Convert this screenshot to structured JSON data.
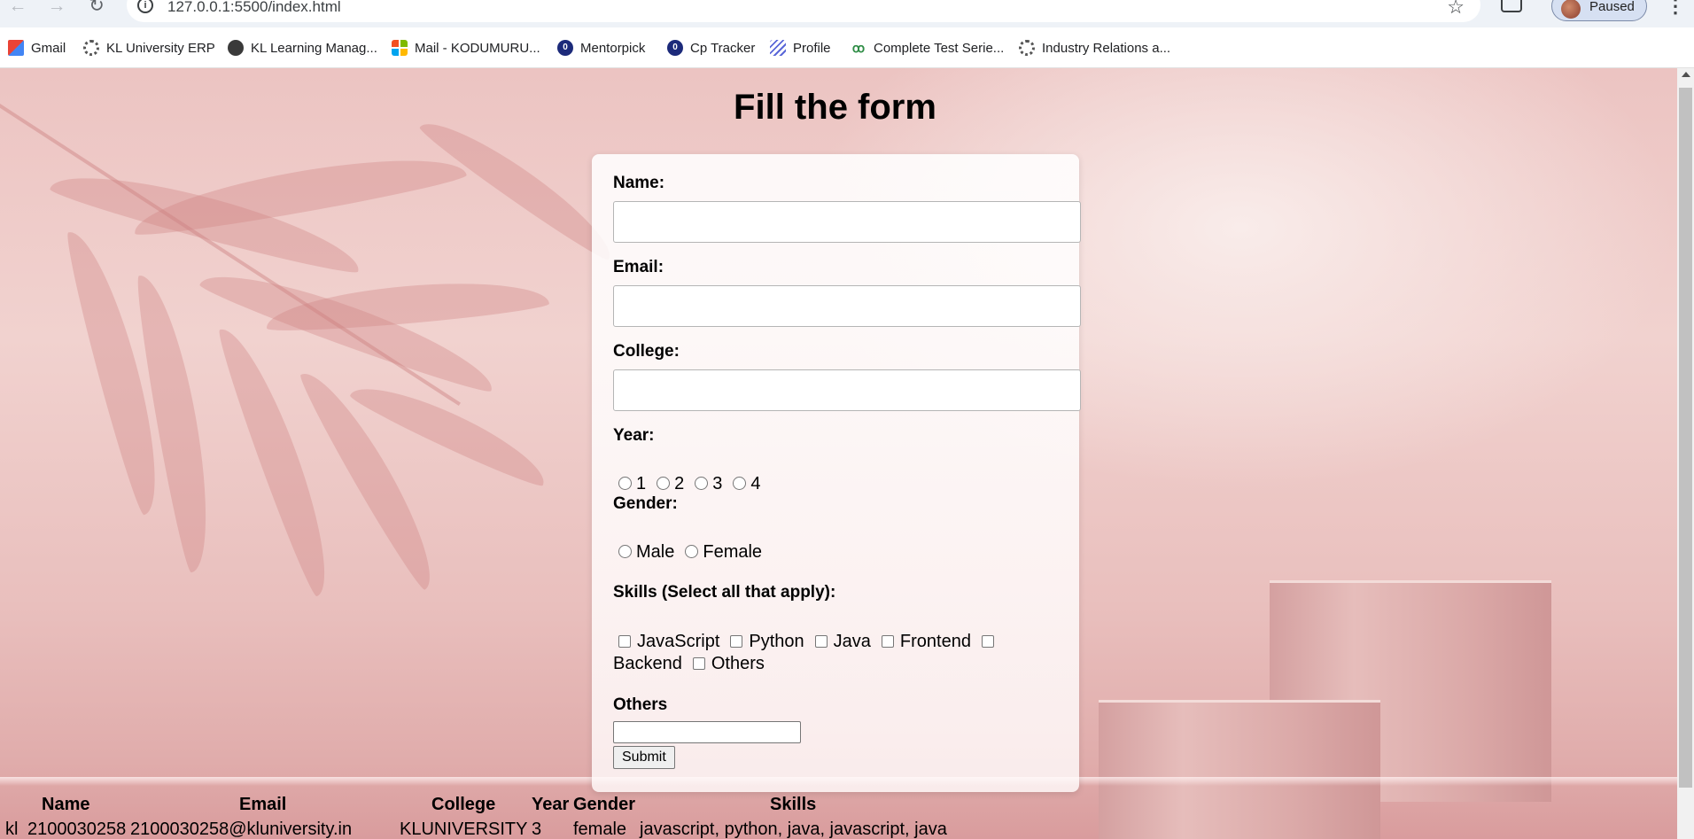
{
  "browser": {
    "url": "127.0.0.1:5500/index.html",
    "profile_status": "Paused",
    "icons": [
      "back-arrow-icon",
      "forward-arrow-icon",
      "reload-icon",
      "site-info-icon",
      "star-icon",
      "extensions-icon",
      "kebab-menu-icon"
    ],
    "nav": {
      "back": "←",
      "forward": "→",
      "reload": "↻",
      "info": "i",
      "star": "☆",
      "menu": "⋮"
    }
  },
  "bookmarks": [
    {
      "label": "Gmail",
      "icon": "gmail-icon"
    },
    {
      "label": "KL University ERP",
      "icon": "gear-icon"
    },
    {
      "label": "KL Learning Manag...",
      "icon": "moodle-icon"
    },
    {
      "label": "Mail - KODUMURU...",
      "icon": "microsoft-icon"
    },
    {
      "label": "Mentorpick",
      "icon": "mentorpick-icon"
    },
    {
      "label": "Cp Tracker",
      "icon": "cp-tracker-icon"
    },
    {
      "label": "Profile",
      "icon": "profile-icon"
    },
    {
      "label": "Complete Test Serie...",
      "icon": "gfg-icon"
    },
    {
      "label": "Industry Relations a...",
      "icon": "gear-icon"
    }
  ],
  "page": {
    "title": "Fill the form"
  },
  "form": {
    "name_label": "Name:",
    "name_value": "",
    "email_label": "Email:",
    "email_value": "",
    "college_label": "College:",
    "college_value": "",
    "year_label": "Year:",
    "year_options": [
      "1",
      "2",
      "3",
      "4"
    ],
    "gender_label": "Gender:",
    "gender_options": [
      "Male",
      "Female"
    ],
    "skills_label": "Skills (Select all that apply):",
    "skills_options": [
      "JavaScript",
      "Python",
      "Java",
      "Frontend",
      "Backend",
      "Others"
    ],
    "others_label": "Others",
    "others_value": "",
    "submit_label": "Submit"
  },
  "table": {
    "headers": [
      "Name",
      "Email",
      "College",
      "Year",
      "Gender",
      "Skills"
    ],
    "rows": [
      [
        "kl",
        "2100030258",
        "2100030258@kluniversity.in",
        "KLUNIVERSITY",
        "3",
        "female",
        "javascript, python, java, javascript, java"
      ]
    ]
  }
}
